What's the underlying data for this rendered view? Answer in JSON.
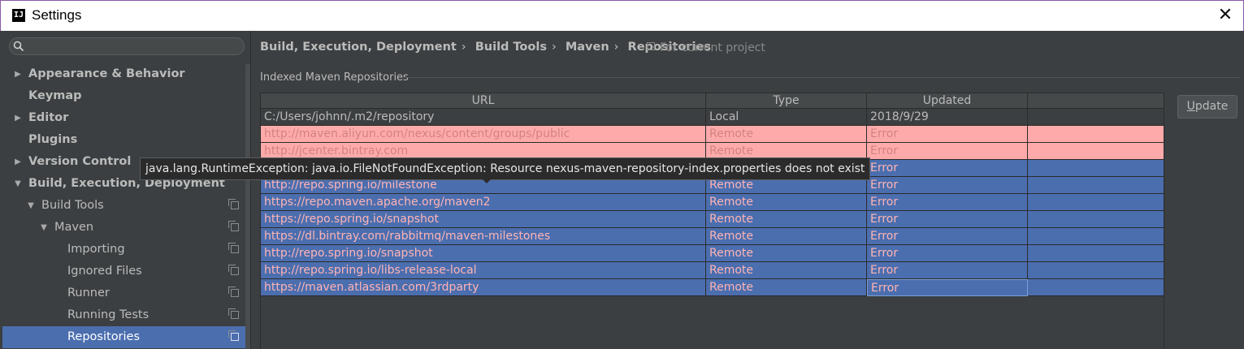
{
  "window": {
    "app_icon": "IJ",
    "title": "Settings",
    "close_glyph": "✕"
  },
  "search": {
    "value": ""
  },
  "sidebar": {
    "items": [
      {
        "label": "Appearance & Behavior",
        "arrow": "▶"
      },
      {
        "label": "Keymap",
        "arrow": ""
      },
      {
        "label": "Editor",
        "arrow": "▶"
      },
      {
        "label": "Plugins",
        "arrow": ""
      },
      {
        "label": "Version Control",
        "arrow": "▶"
      },
      {
        "label": "Build, Execution, Deployment",
        "arrow": "▼"
      },
      {
        "label": "Build Tools",
        "arrow": "▼"
      },
      {
        "label": "Maven",
        "arrow": "▼"
      },
      {
        "label": "Importing",
        "arrow": ""
      },
      {
        "label": "Ignored Files",
        "arrow": ""
      },
      {
        "label": "Runner",
        "arrow": ""
      },
      {
        "label": "Running Tests",
        "arrow": ""
      },
      {
        "label": "Repositories",
        "arrow": ""
      }
    ]
  },
  "breadcrumb": {
    "parts": [
      "Build, Execution, Deployment",
      "Build Tools",
      "Maven",
      "Repositories"
    ],
    "separator": "›",
    "note": "For current project"
  },
  "section": {
    "title": "Indexed Maven Repositories"
  },
  "table": {
    "columns": [
      "URL",
      "Type",
      "Updated"
    ],
    "rows": [
      {
        "url": "C:/Users/johnn/.m2/repository",
        "type": "Local",
        "updated": "2018/9/29"
      },
      {
        "url": "http://maven.aliyun.com/nexus/content/groups/public",
        "type": "Remote",
        "updated": "Error"
      },
      {
        "url": "http://jcenter.bintray.com",
        "type": "Remote",
        "updated": "Error"
      },
      {
        "url": "",
        "type": "",
        "updated": "Error"
      },
      {
        "url": "http://repo.spring.io/milestone",
        "type": "Remote",
        "updated": "Error"
      },
      {
        "url": "https://repo.maven.apache.org/maven2",
        "type": "Remote",
        "updated": "Error"
      },
      {
        "url": "https://repo.spring.io/snapshot",
        "type": "Remote",
        "updated": "Error"
      },
      {
        "url": "https://dl.bintray.com/rabbitmq/maven-milestones",
        "type": "Remote",
        "updated": "Error"
      },
      {
        "url": "http://repo.spring.io/snapshot",
        "type": "Remote",
        "updated": "Error"
      },
      {
        "url": "http://repo.spring.io/libs-release-local",
        "type": "Remote",
        "updated": "Error"
      },
      {
        "url": "https://maven.atlassian.com/3rdparty",
        "type": "Remote",
        "updated": "Error"
      }
    ]
  },
  "update_button": {
    "label_rest": "pdate",
    "label_mnemonic": "U"
  },
  "tooltip": {
    "text": "java.lang.RuntimeException: java.io.FileNotFoundException: Resource nexus-maven-repository-index.properties does not exist"
  },
  "colors": {
    "background": "#3c3f41",
    "selection": "#4b6eaf",
    "error_row": "#ffaaaa",
    "error_text_selected": "#ffb4b4",
    "window_border": "#8a5aa8"
  },
  "icons": [
    "search-icon",
    "close-icon",
    "copy-icon",
    "project-icon"
  ]
}
